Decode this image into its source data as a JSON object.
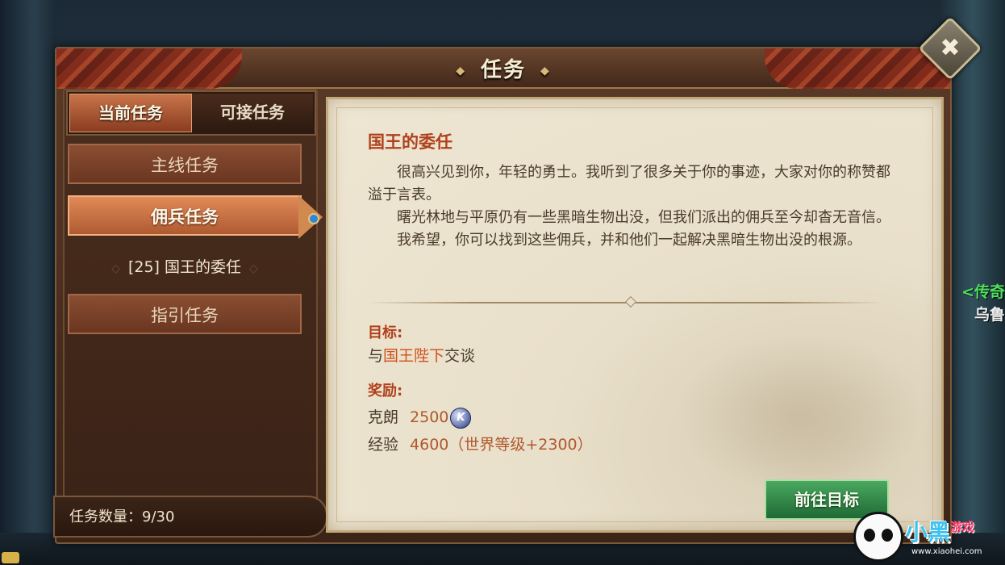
{
  "window": {
    "title": "任务"
  },
  "tabs": [
    {
      "label": "当前任务",
      "active": true
    },
    {
      "label": "可接任务",
      "active": false
    }
  ],
  "categories": {
    "main": "主线任务",
    "mercenary": "佣兵任务",
    "guide": "指引任务"
  },
  "selected_quest": {
    "level": "[25]",
    "name": "国王的委任"
  },
  "quest_count": {
    "label": "任务数量：",
    "value": "9/30"
  },
  "detail": {
    "title": "国王的委任",
    "paragraphs": [
      "很高兴见到你，年轻的勇士。我听到了很多关于你的事迹，大家对你的称赞都溢于言表。",
      "曙光林地与平原仍有一些黑暗生物出没，但我们派出的佣兵至今却杳无音信。",
      "我希望，你可以找到这些佣兵，并和他们一起解决黑暗生物出没的根源。"
    ],
    "objective_label": "目标:",
    "objective_prefix": "与",
    "objective_npc": "国王陛下",
    "objective_suffix": "交谈",
    "reward_label": "奖励:",
    "rewards": [
      {
        "name": "克朗",
        "value": "2500",
        "icon": "k-coin-icon"
      },
      {
        "name": "经验",
        "value": "4600（世界等级+2300）"
      }
    ],
    "go_button": "前往目标"
  },
  "side_text": {
    "line1": "<传奇",
    "line2": "乌鲁"
  },
  "watermark": {
    "brand": "小黑",
    "sub": "游戏",
    "url": "www.xiaohei.com"
  },
  "colors": {
    "accent_red": "#b0401c",
    "button_green": "#2f8a46",
    "tab_orange": "#c8744a"
  }
}
